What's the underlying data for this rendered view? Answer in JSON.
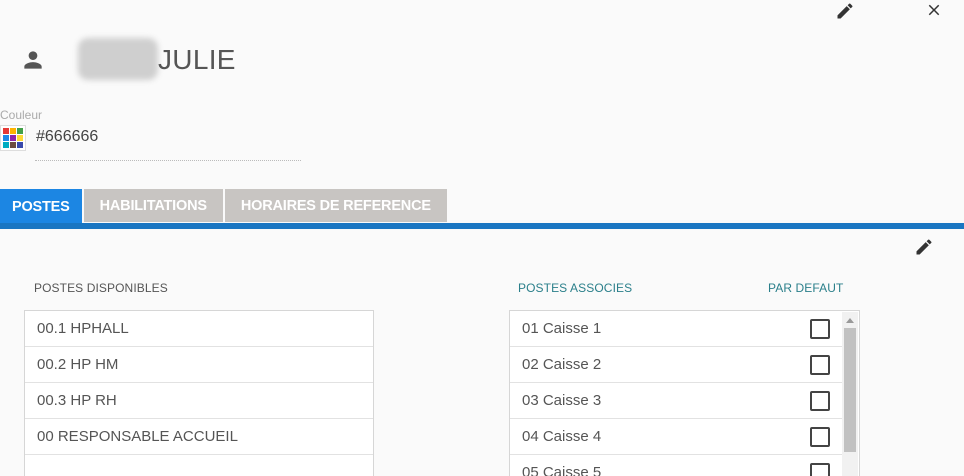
{
  "header": {
    "name": "JULIE",
    "edit_icon": "pencil-icon",
    "close_icon": "close-icon",
    "person_icon": "person-icon"
  },
  "couleur": {
    "label": "Couleur",
    "value": "#666666",
    "swatch_colors": [
      "#e53935",
      "#ffb300",
      "#43a047",
      "#1e88e5",
      "#8e24aa",
      "#fdd835",
      "#00acc1",
      "#6d4c41",
      "#3949ab"
    ]
  },
  "tabs": [
    {
      "label": "POSTES",
      "active": true
    },
    {
      "label": "HABILITATIONS",
      "active": false
    },
    {
      "label": "HORAIRES DE REFERENCE",
      "active": false
    }
  ],
  "postes": {
    "disponibles_label": "POSTES DISPONIBLES",
    "associes_label": "POSTES ASSOCIES",
    "defaut_label": "PAR DEFAUT",
    "disponibles": [
      "00.1 HPHALL",
      "00.2 HP HM",
      "00.3 HP RH",
      "00 RESPONSABLE ACCUEIL",
      ""
    ],
    "associes": [
      "01 Caisse 1",
      "02 Caisse 2",
      "03 Caisse 3",
      "04 Caisse 4",
      "05 Caisse 5"
    ]
  },
  "colors": {
    "accent": "#1c86e3",
    "tab_inactive": "#c8c5c2",
    "teal_label": "#2a7f8a"
  }
}
